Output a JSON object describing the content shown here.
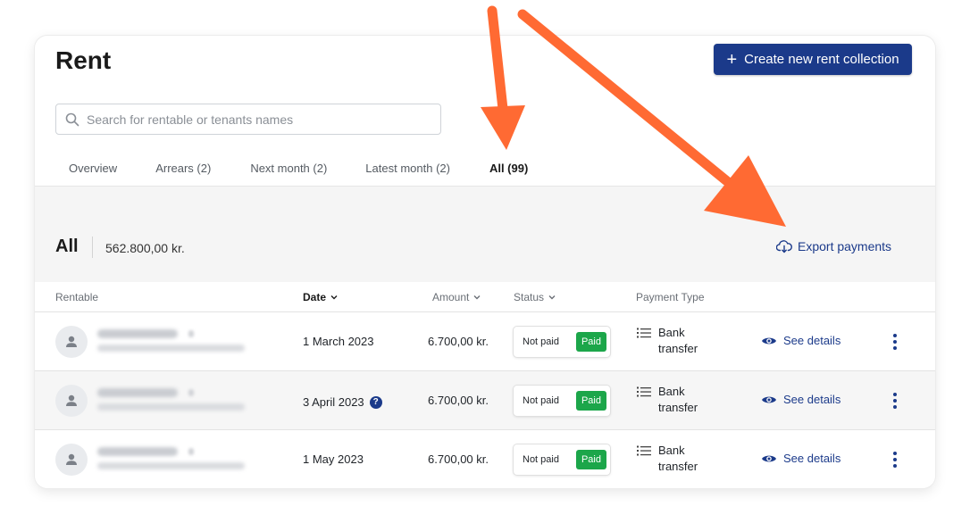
{
  "page": {
    "title": "Rent",
    "create_button": "Create new rent collection"
  },
  "search": {
    "placeholder": "Search for rentable or tenants names",
    "value": ""
  },
  "tabs": [
    {
      "label": "Overview",
      "active": false
    },
    {
      "label": "Arrears (2)",
      "active": false
    },
    {
      "label": "Next month (2)",
      "active": false
    },
    {
      "label": "Latest month (2)",
      "active": false
    },
    {
      "label": "All (99)",
      "active": true
    }
  ],
  "summary": {
    "label": "All",
    "total": "562.800,00 kr.",
    "export_label": "Export payments"
  },
  "table": {
    "columns": {
      "rentable": "Rentable",
      "date": "Date",
      "amount": "Amount",
      "status": "Status",
      "payment_type": "Payment Type"
    },
    "rows": [
      {
        "date": "1 March 2023",
        "amount": "6.700,00 kr.",
        "status_off": "Not paid",
        "status_on": "Paid",
        "payment_type_1": "Bank",
        "payment_type_2": "transfer",
        "details": "See details",
        "help": ""
      },
      {
        "date": "3 April 2023",
        "amount": "6.700,00 kr.",
        "status_off": "Not paid",
        "status_on": "Paid",
        "payment_type_1": "Bank",
        "payment_type_2": "transfer",
        "details": "See details",
        "help": "?"
      },
      {
        "date": "1 May 2023",
        "amount": "6.700,00 kr.",
        "status_off": "Not paid",
        "status_on": "Paid",
        "payment_type_1": "Bank",
        "payment_type_2": "transfer",
        "details": "See details",
        "help": ""
      }
    ]
  },
  "colors": {
    "primary": "#1b3a8a",
    "paid": "#1ca64a",
    "annotation_arrow": "#ff6a33"
  }
}
